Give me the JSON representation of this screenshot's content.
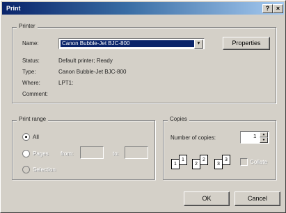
{
  "window": {
    "title": "Print",
    "help_btn": "?",
    "close_btn": "×"
  },
  "printer": {
    "group_label": "Printer",
    "name_label": "Name:",
    "name_value": "Canon Bubble-Jet BJC-800",
    "properties_label": "Properties",
    "status_label": "Status:",
    "status_value": "Default printer; Ready",
    "type_label": "Type:",
    "type_value": "Canon Bubble-Jet BJC-800",
    "where_label": "Where:",
    "where_value": "LPT1:",
    "comment_label": "Comment:",
    "comment_value": ""
  },
  "print_range": {
    "group_label": "Print range",
    "all_label": "All",
    "pages_label": "Pages",
    "from_label": "from:",
    "to_label": "to:",
    "selection_label": "Selection",
    "selected": "all"
  },
  "copies": {
    "group_label": "Copies",
    "number_label": "Number of copies:",
    "number_value": "1",
    "collate_label": "Collate",
    "collate_checked": false,
    "pages": [
      "1",
      "1",
      "2",
      "2",
      "3",
      "3"
    ]
  },
  "buttons": {
    "ok": "OK",
    "cancel": "Cancel"
  },
  "icons": {
    "dropdown": "chevron-down-icon",
    "spin_up": "arrow-up-icon",
    "spin_down": "arrow-down-icon"
  }
}
